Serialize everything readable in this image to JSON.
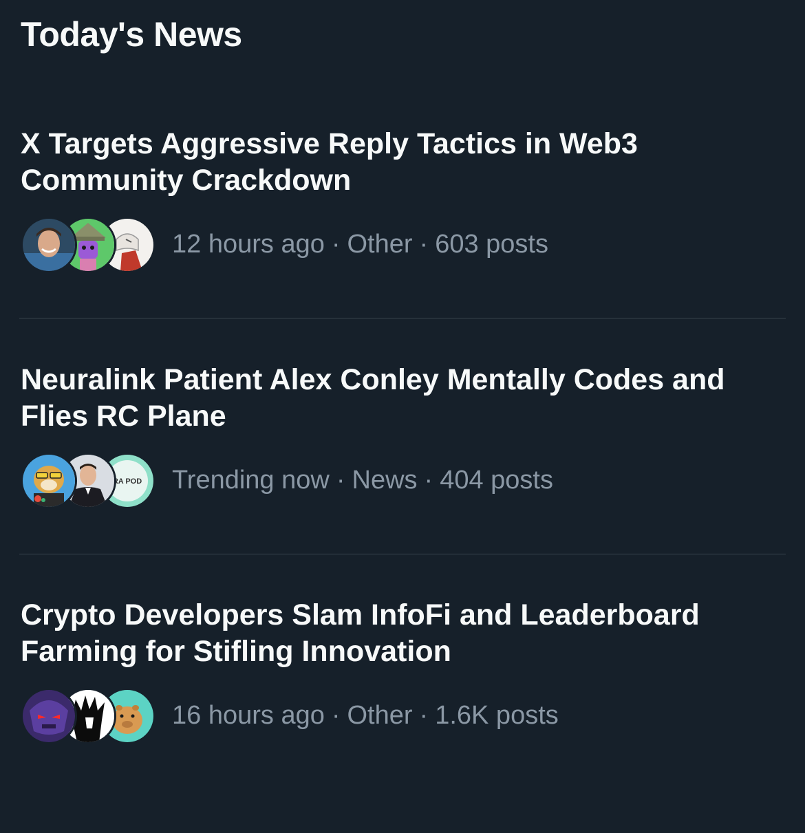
{
  "section": {
    "title": "Today's News"
  },
  "items": [
    {
      "headline_line1": "X Targets Aggressive Reply Tactics in Web3",
      "headline_line2": "Community Crackdown",
      "time": "12 hours ago",
      "category": "Other",
      "posts": "603 posts",
      "avatars": [
        "person-photo-avatar",
        "purple-wizard-avatar",
        "white-sketch-avatar"
      ]
    },
    {
      "headline_line1": "Neuralink Patient Alex Conley Mentally Codes and",
      "headline_line2": "Flies RC Plane",
      "time": "Trending now",
      "category": "News",
      "posts": "404 posts",
      "avatars": [
        "doge-painter-avatar",
        "man-in-suit-avatar",
        "podcast-logo-avatar"
      ],
      "avatar_text": "RA POD"
    },
    {
      "headline_line1": "Crypto Developers Slam InfoFi and Leaderboard",
      "headline_line2": "Farming for Stifling Innovation",
      "time": "16 hours ago",
      "category": "Other",
      "posts": "1.6K posts",
      "avatars": [
        "red-eyed-warrior-avatar",
        "spiky-hair-avatar",
        "capybara-avatar"
      ]
    }
  ],
  "separator": "·",
  "colors": {
    "background": "#16202a",
    "text": "#f7f9f9",
    "secondary": "#8b98a5",
    "divider": "#38444d"
  }
}
